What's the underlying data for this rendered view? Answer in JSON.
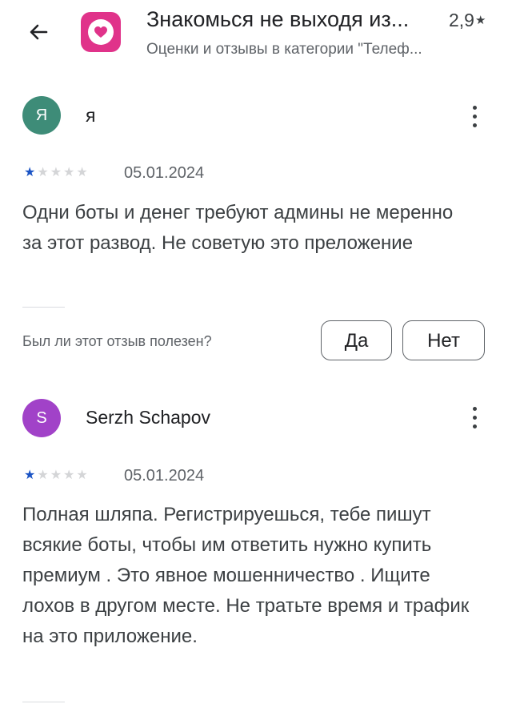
{
  "header": {
    "title": "Знакомься не выходя из...",
    "rating": "2,9",
    "rating_star": "★",
    "subtitle": "Оценки и отзывы в категории \"Телеф...",
    "app_icon_color": "#e0338a"
  },
  "reviews": [
    {
      "avatar_letter": "Я",
      "avatar_color": "#3e8c78",
      "author": "я",
      "stars": 1,
      "date": "05.01.2024",
      "text": "Одни боты и денег требуют админы не меренно за этот развод. Не советую это преложение"
    },
    {
      "avatar_letter": "S",
      "avatar_color": "#a142c8",
      "author": "Serzh Schapov",
      "stars": 1,
      "date": "05.01.2024",
      "text": "Полная шляпа. Регистрируешься, тебе пишут всякие боты, чтобы им ответить нужно купить премиум . Это явное мошенничество . Ищите лохов в другом месте. Не тратьте время и трафик на это приложение."
    }
  ],
  "helpful": {
    "question": "Был ли этот отзыв полезен?",
    "yes": "Да",
    "no": "Нет"
  }
}
